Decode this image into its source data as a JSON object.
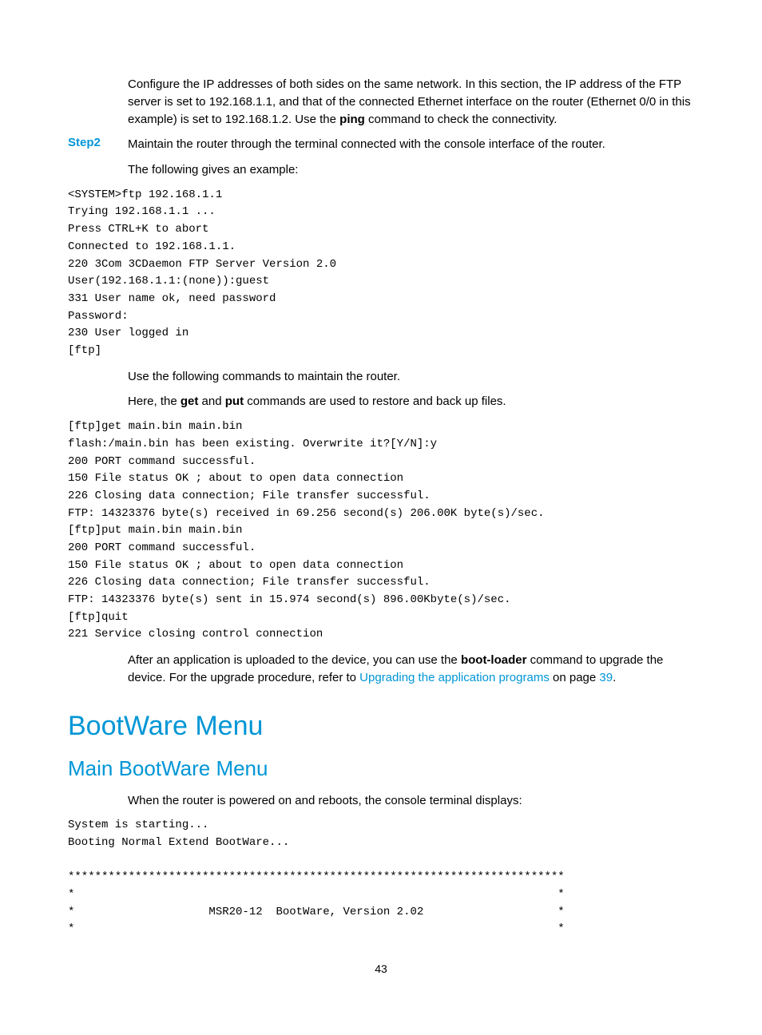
{
  "p1_prefix": "Configure the IP addresses of both sides on the same network. In this section, the IP address of the FTP server is set to 192.168.1.1, and that of the connected Ethernet interface on the router (Ethernet 0/0 in this example) is set to 192.168.1.2. Use the ",
  "p1_bold": "ping",
  "p1_suffix": " command to check the connectivity.",
  "step2_label": "Step2",
  "step2_text": "Maintain the router through the terminal connected with the console interface of the router.",
  "p2": "The following gives an example:",
  "code1": "<SYSTEM>ftp 192.168.1.1\nTrying 192.168.1.1 ...\nPress CTRL+K to abort\nConnected to 192.168.1.1.\n220 3Com 3CDaemon FTP Server Version 2.0\nUser(192.168.1.1:(none)):guest\n331 User name ok, need password\nPassword:\n230 User logged in\n[ftp]",
  "p3": "Use the following commands to maintain the router.",
  "p4_prefix": "Here, the ",
  "p4_b1": "get",
  "p4_mid": " and ",
  "p4_b2": "put",
  "p4_suffix": " commands are used to restore and back up files.",
  "code2": "[ftp]get main.bin main.bin\nflash:/main.bin has been existing. Overwrite it?[Y/N]:y\n200 PORT command successful.\n150 File status OK ; about to open data connection\n226 Closing data connection; File transfer successful.\nFTP: 14323376 byte(s) received in 69.256 second(s) 206.00K byte(s)/sec.\n[ftp]put main.bin main.bin\n200 PORT command successful.\n150 File status OK ; about to open data connection\n226 Closing data connection; File transfer successful.\nFTP: 14323376 byte(s) sent in 15.974 second(s) 896.00Kbyte(s)/sec.\n[ftp]quit\n221 Service closing control connection",
  "p5_prefix": "After an application is uploaded to the device, you can use the ",
  "p5_bold": "boot-loader",
  "p5_mid": " command to upgrade the device. For the upgrade procedure, refer to ",
  "p5_link": "Upgrading the application programs",
  "p5_on": " on page ",
  "p5_page": "39",
  "p5_suffix": ".",
  "h1": "BootWare Menu",
  "h2": "Main BootWare Menu",
  "p6": "When the router is powered on and reboots, the console terminal displays:",
  "code3": "System is starting...\nBooting Normal Extend BootWare...\n\n**************************************************************************\n*                                                                        *\n*                    MSR20-12  BootWare, Version 2.02                    *\n*                                                                        *",
  "page_number": "43"
}
